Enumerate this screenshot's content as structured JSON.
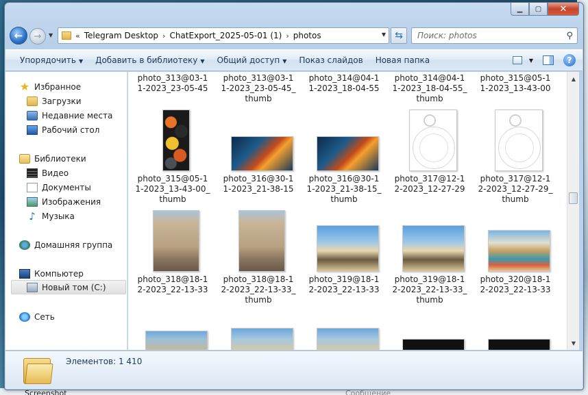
{
  "window": {
    "caption": {
      "minimize": "▁",
      "maximize": "▢",
      "close": "✕"
    }
  },
  "nav": {
    "back_icon": "←",
    "forward_icon": "→",
    "history_icon": "▼",
    "address": {
      "lead_chevron": "«",
      "crumbs": [
        "Telegram Desktop",
        "ChatExport_2025-05-01 (1)",
        "photos"
      ],
      "separator": "›",
      "dropdown": "▼"
    },
    "refresh_icon": "⇆",
    "search": {
      "placeholder": "Поиск: photos",
      "icon": "⚲"
    }
  },
  "toolbar": {
    "organize": "Упорядочить",
    "add_to_library": "Добавить в библиотеку",
    "share": "Общий доступ",
    "slideshow": "Показ слайдов",
    "new_folder": "Новая папка",
    "caret": "▼",
    "help": "?"
  },
  "navpane": {
    "favorites": "Избранное",
    "downloads": "Загрузки",
    "recent": "Недавние места",
    "desktop": "Рабочий стол",
    "libraries": "Библиотеки",
    "video": "Видео",
    "documents": "Документы",
    "images": "Изображения",
    "music": "Музыка",
    "homegroup": "Домашняя группа",
    "computer": "Компьютер",
    "drive_c": "Новый том (C:)",
    "network": "Сеть"
  },
  "files": {
    "row0": [
      [
        "photo_313@03-1",
        "1-2023_23-05-45",
        ""
      ],
      [
        "photo_313@03-1",
        "1-2023_23-05-45_",
        "thumb"
      ],
      [
        "photo_314@04-1",
        "1-2023_18-04-55",
        ""
      ],
      [
        "photo_314@04-1",
        "1-2023_18-04-55_",
        "thumb"
      ],
      [
        "photo_315@05-1",
        "1-2023_13-43-00",
        ""
      ]
    ],
    "row1": [
      [
        "photo_315@05-1",
        "1-2023_13-43-00_",
        "thumb"
      ],
      [
        "photo_316@30-1",
        "1-2023_21-38-15",
        ""
      ],
      [
        "photo_316@30-1",
        "1-2023_21-38-15_",
        "thumb"
      ],
      [
        "photo_317@12-1",
        "2-2023_12-27-29",
        ""
      ],
      [
        "photo_317@12-1",
        "2-2023_12-27-29_",
        "thumb"
      ]
    ],
    "row2": [
      [
        "photo_318@18-1",
        "2-2023_22-13-33",
        ""
      ],
      [
        "photo_318@18-1",
        "2-2023_22-13-33_",
        "thumb"
      ],
      [
        "photo_319@18-1",
        "2-2023_22-13-33",
        ""
      ],
      [
        "photo_319@18-1",
        "2-2023_22-13-33_",
        "thumb"
      ],
      [
        "photo_320@18-1",
        "2-2023_22-13-33",
        ""
      ]
    ]
  },
  "scroll": {
    "up": "▲",
    "down": "▼"
  },
  "details": {
    "count": "Элементов: 1 410"
  },
  "background": {
    "taskbar_left": "Screenshot",
    "taskbar_right": "Сообщение"
  }
}
